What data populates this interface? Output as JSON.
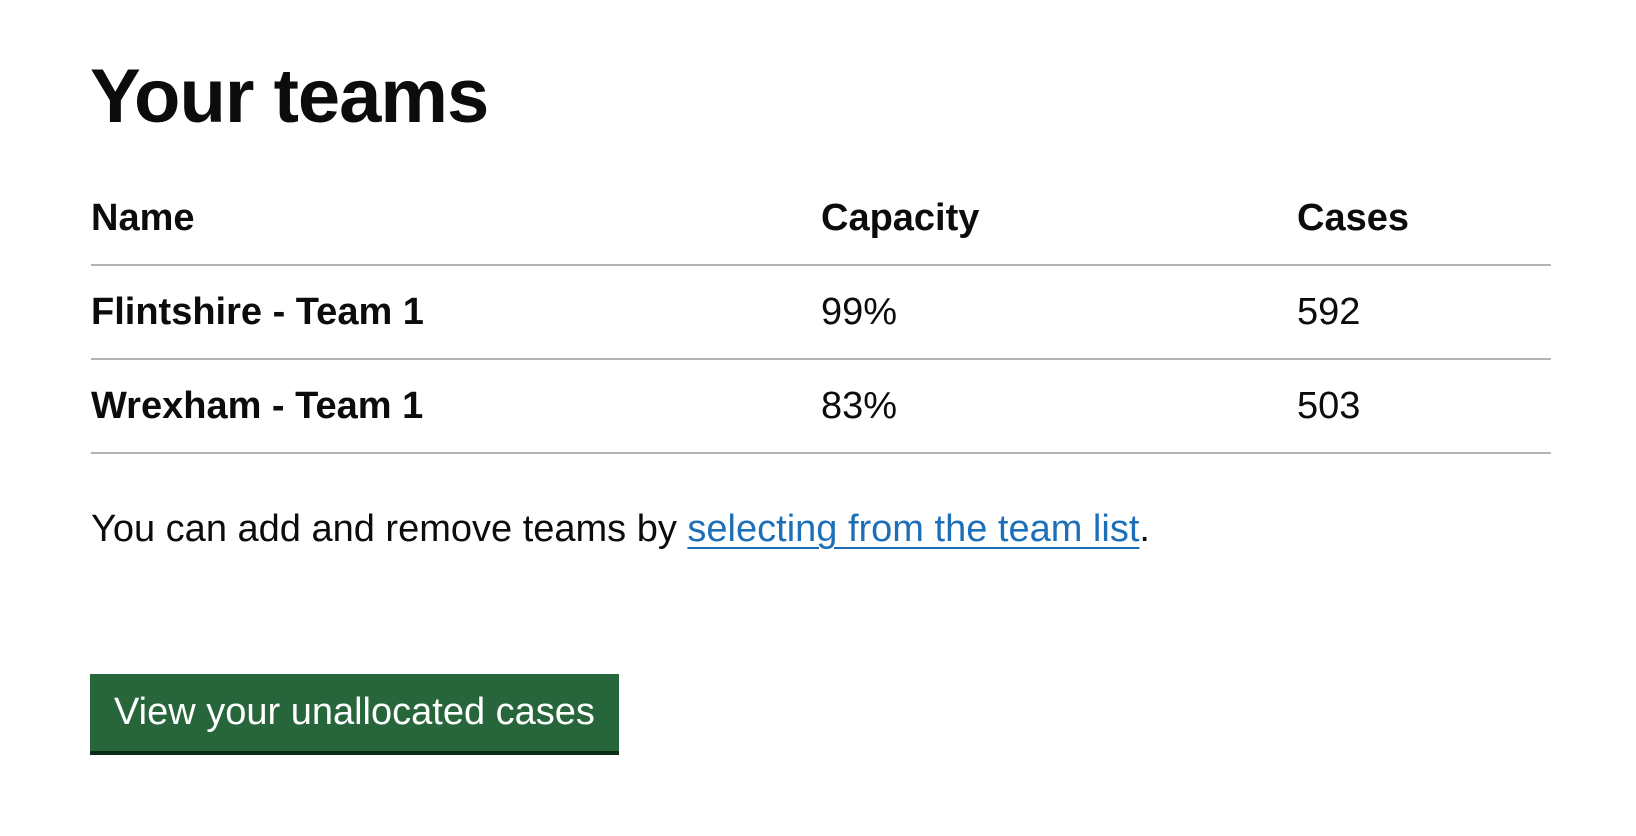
{
  "page": {
    "title": "Your teams"
  },
  "table": {
    "headers": {
      "name": "Name",
      "capacity": "Capacity",
      "cases": "Cases"
    },
    "rows": [
      {
        "name": "Flintshire - Team 1",
        "capacity": "99%",
        "cases": "592"
      },
      {
        "name": "Wrexham - Team 1",
        "capacity": "83%",
        "cases": "503"
      }
    ]
  },
  "hint": {
    "text_before": "You can add and remove teams by ",
    "link_text": "selecting from the team list",
    "text_after": "."
  },
  "actions": {
    "primary_button_label": "View your unallocated cases"
  },
  "colors": {
    "text": "#0b0c0c",
    "link": "#1d70b8",
    "button": "#27663b",
    "border": "#b1b4b6"
  }
}
